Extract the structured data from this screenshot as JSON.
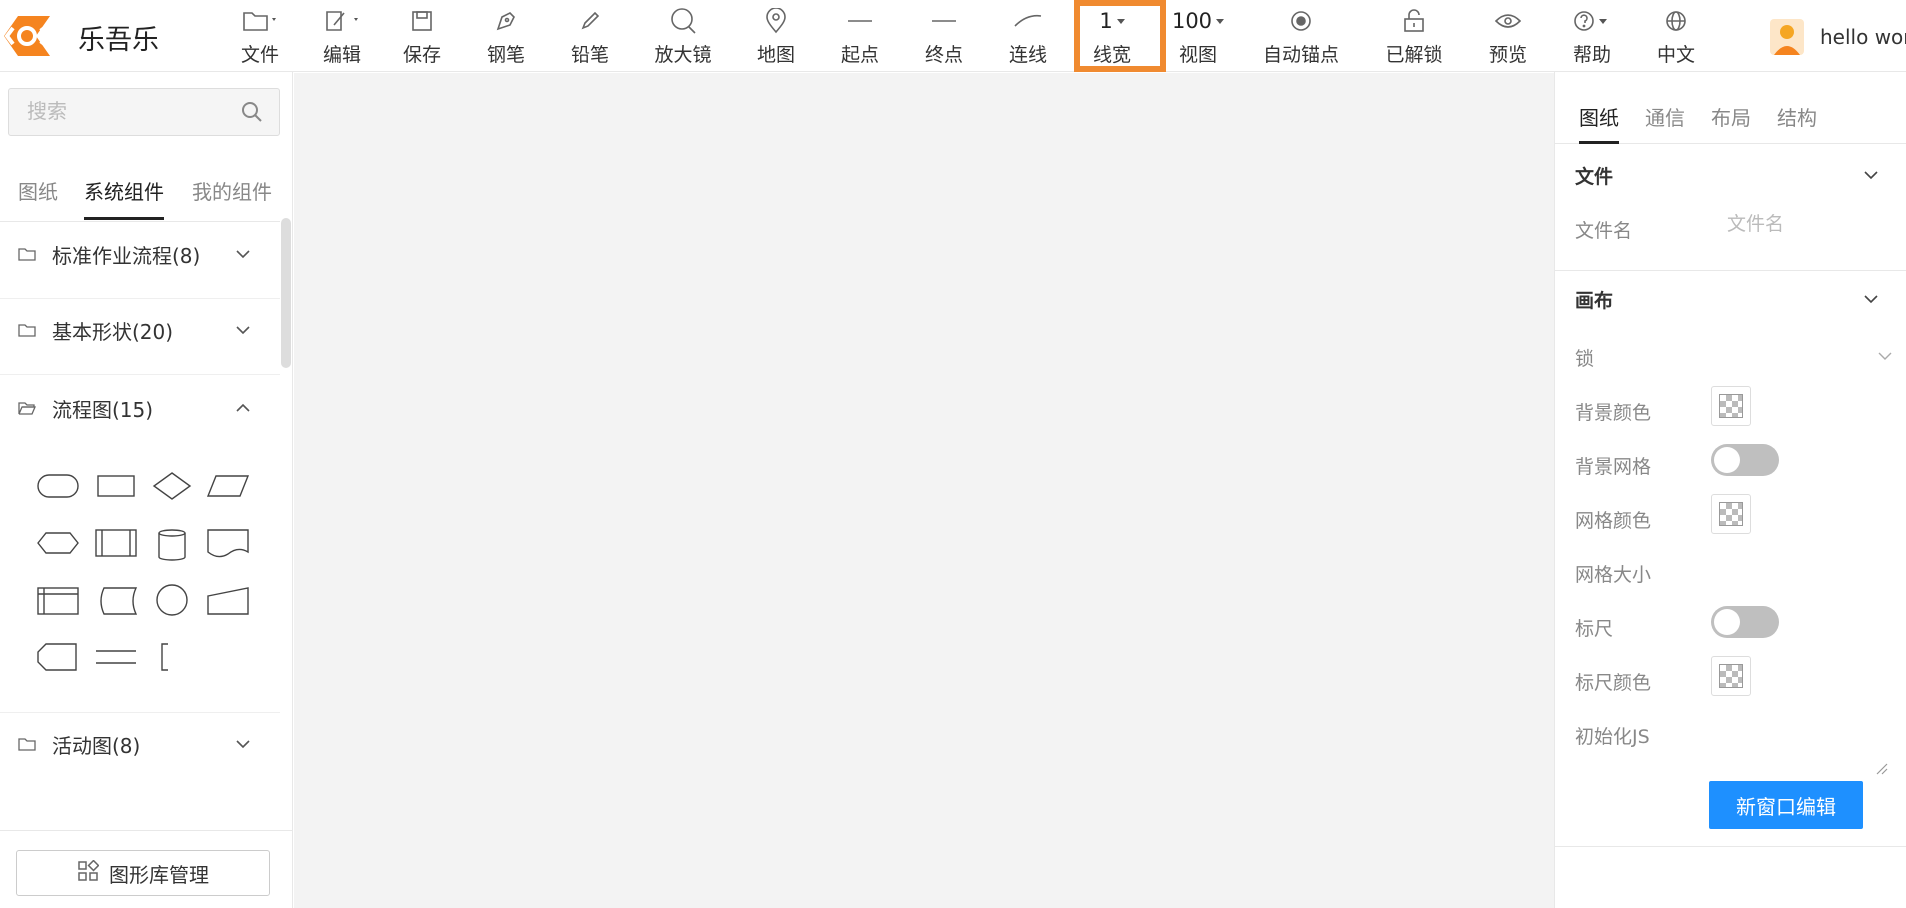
{
  "app": {
    "name": "乐吾乐"
  },
  "toolbar": {
    "file": "文件",
    "edit": "编辑",
    "save": "保存",
    "pen": "钢笔",
    "pencil": "铅笔",
    "magnifier": "放大镜",
    "map": "地图",
    "start": "起点",
    "end": "终点",
    "connect": "连线",
    "line_width_value": "1",
    "line_width": "线宽",
    "view_value": "100",
    "view": "视图",
    "auto_anchor": "自动锚点",
    "unlocked": "已解锁",
    "preview": "预览",
    "help": "帮助",
    "language": "中文"
  },
  "user": {
    "name": "hello world"
  },
  "line_width_popup": {
    "value": "1"
  },
  "left_panel": {
    "search_placeholder": "搜索",
    "tabs": [
      "图纸",
      "系统组件",
      "我的组件"
    ],
    "active_tab": "系统组件",
    "categories": [
      {
        "label": "标准作业流程(8)",
        "expanded": false
      },
      {
        "label": "基本形状(20)",
        "expanded": false
      },
      {
        "label": "流程图(15)",
        "expanded": true
      },
      {
        "label": "活动图(8)",
        "expanded": false
      }
    ],
    "library_button": "图形库管理"
  },
  "right_panel": {
    "tabs": [
      "图纸",
      "通信",
      "布局",
      "结构"
    ],
    "active_tab": "图纸",
    "file_section": {
      "title": "文件",
      "filename_label": "文件名",
      "filename_placeholder": "文件名"
    },
    "canvas_section": {
      "title": "画布",
      "lock": "锁",
      "background_color": "背景颜色",
      "background_grid": "背景网格",
      "grid_color": "网格颜色",
      "grid_size": "网格大小",
      "ruler": "标尺",
      "ruler_color": "标尺颜色",
      "init_js": "初始化JS",
      "background_grid_on": false,
      "ruler_on": false
    },
    "new_window_button": "新窗口编辑"
  },
  "colors": {
    "accent": "#1e90ff",
    "highlight": "#f08a30",
    "logo": "#f5841f"
  }
}
